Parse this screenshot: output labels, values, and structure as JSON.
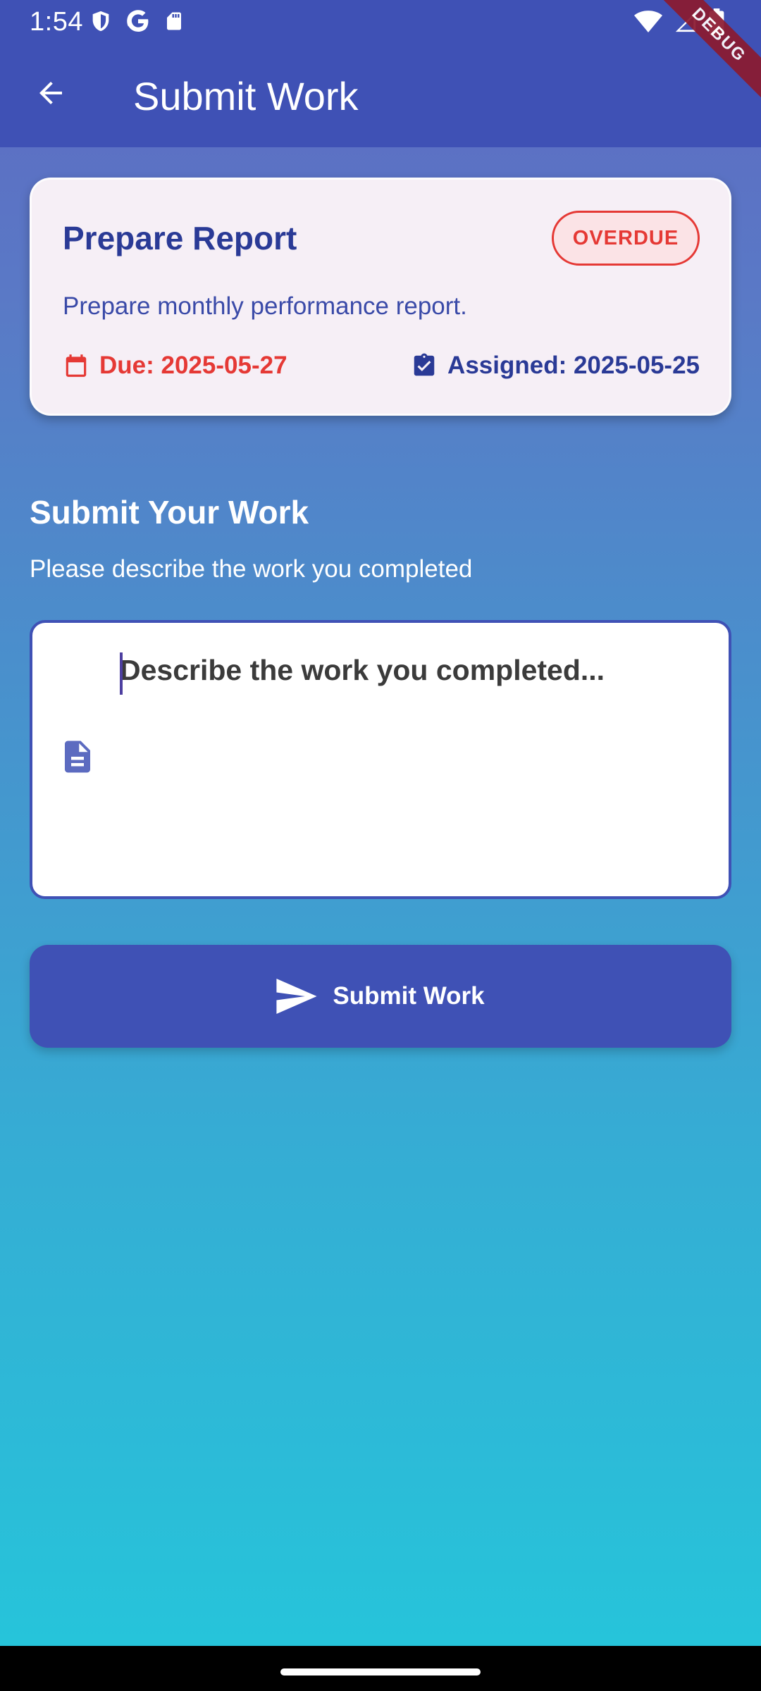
{
  "status_bar": {
    "time": "1:54",
    "left_icons": [
      "shield-icon",
      "google-icon",
      "sd-card-icon"
    ],
    "right_icons": [
      "wifi-icon",
      "signal-icon",
      "battery-icon"
    ]
  },
  "debug_banner": "DEBUG",
  "app_bar": {
    "title": "Submit Work",
    "back_icon": "arrow-back-icon",
    "background": "#3f51b5"
  },
  "task": {
    "title": "Prepare Report",
    "status_badge": "OVERDUE",
    "description": "Prepare monthly performance report.",
    "due_label": "Due: 2025-05-27",
    "assigned_label": "Assigned: 2025-05-25",
    "due_color": "#e53935",
    "accent_color": "#2a3a96"
  },
  "form": {
    "section_title": "Submit Your Work",
    "section_subtitle": "Please describe the work you completed",
    "input_placeholder": "Describe the work you completed...",
    "input_icon": "description-icon",
    "submit_label": "Submit Work",
    "submit_icon": "send-icon"
  },
  "colors": {
    "gradient_top": "#5d69c2",
    "gradient_bottom": "#26c4da",
    "primary": "#3f51b5"
  }
}
